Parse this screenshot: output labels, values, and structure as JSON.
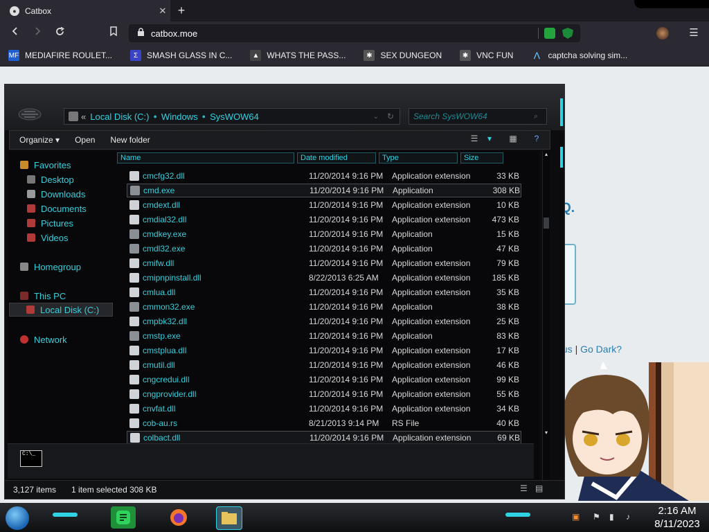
{
  "browser": {
    "tab_title": "Catbox",
    "tab_close": "✕",
    "new_tab": "+",
    "url": "catbox.moe",
    "bookmarks": [
      {
        "label": "MEDIAFIRE ROULET...",
        "icon": "mediafire-icon",
        "color": "#1f5fd1"
      },
      {
        "label": "SMASH GLASS IN C...",
        "icon": "smash-icon",
        "color": "#3b44c9"
      },
      {
        "label": "WHATS THE PASS...",
        "icon": "anon-icon",
        "color": "#444444"
      },
      {
        "label": "SEX DUNGEON",
        "icon": "spider-icon",
        "color": "#555555"
      },
      {
        "label": "VNC FUN",
        "icon": "spider-icon",
        "color": "#555555"
      },
      {
        "label": "captcha solving sim...",
        "icon": "a-logo-icon",
        "color": "#2b2a33"
      }
    ]
  },
  "webpage": {
    "fragment": "Q.",
    "link1": "tus",
    "separator": "|",
    "link2": "Go Dark?"
  },
  "explorer": {
    "address": [
      "Local Disk (C:)",
      "Windows",
      "SysWOW64"
    ],
    "address_prefix": "«",
    "search_placeholder": "Search SysWOW64",
    "commands": {
      "organize": "Organize ▾",
      "open": "Open",
      "new_folder": "New folder"
    },
    "nav": {
      "favorites": "Favorites",
      "desktop": "Desktop",
      "downloads": "Downloads",
      "documents": "Documents",
      "pictures": "Pictures",
      "videos": "Videos",
      "homegroup": "Homegroup",
      "this_pc": "This PC",
      "local_disk": "Local Disk (C:)",
      "network": "Network"
    },
    "columns": {
      "name": "Name",
      "date": "Date modified",
      "type": "Type",
      "size": "Size"
    },
    "files": [
      {
        "name": "cmcfg32.dll",
        "date": "11/20/2014 9:16 PM",
        "type": "Application extension",
        "size": "33 KB"
      },
      {
        "name": "cmd.exe",
        "date": "11/20/2014 9:16 PM",
        "type": "Application",
        "size": "308 KB"
      },
      {
        "name": "cmdext.dll",
        "date": "11/20/2014 9:16 PM",
        "type": "Application extension",
        "size": "10 KB"
      },
      {
        "name": "cmdial32.dll",
        "date": "11/20/2014 9:16 PM",
        "type": "Application extension",
        "size": "473 KB"
      },
      {
        "name": "cmdkey.exe",
        "date": "11/20/2014 9:16 PM",
        "type": "Application",
        "size": "15 KB"
      },
      {
        "name": "cmdl32.exe",
        "date": "11/20/2014 9:16 PM",
        "type": "Application",
        "size": "47 KB"
      },
      {
        "name": "cmifw.dll",
        "date": "11/20/2014 9:16 PM",
        "type": "Application extension",
        "size": "79 KB"
      },
      {
        "name": "cmipnpinstall.dll",
        "date": "8/22/2013 6:25 AM",
        "type": "Application extension",
        "size": "185 KB"
      },
      {
        "name": "cmlua.dll",
        "date": "11/20/2014 9:16 PM",
        "type": "Application extension",
        "size": "35 KB"
      },
      {
        "name": "cmmon32.exe",
        "date": "11/20/2014 9:16 PM",
        "type": "Application",
        "size": "38 KB"
      },
      {
        "name": "cmpbk32.dll",
        "date": "11/20/2014 9:16 PM",
        "type": "Application extension",
        "size": "25 KB"
      },
      {
        "name": "cmstp.exe",
        "date": "11/20/2014 9:16 PM",
        "type": "Application",
        "size": "83 KB"
      },
      {
        "name": "cmstplua.dll",
        "date": "11/20/2014 9:16 PM",
        "type": "Application extension",
        "size": "17 KB"
      },
      {
        "name": "cmutil.dll",
        "date": "11/20/2014 9:16 PM",
        "type": "Application extension",
        "size": "46 KB"
      },
      {
        "name": "cngcredui.dll",
        "date": "11/20/2014 9:16 PM",
        "type": "Application extension",
        "size": "99 KB"
      },
      {
        "name": "cngprovider.dll",
        "date": "11/20/2014 9:16 PM",
        "type": "Application extension",
        "size": "55 KB"
      },
      {
        "name": "cnvfat.dll",
        "date": "11/20/2014 9:16 PM",
        "type": "Application extension",
        "size": "34 KB"
      },
      {
        "name": "cob-au.rs",
        "date": "8/21/2013 9:14 PM",
        "type": "RS File",
        "size": "40 KB"
      },
      {
        "name": "colbact.dll",
        "date": "11/20/2014 9:16 PM",
        "type": "Application extension",
        "size": "69 KB"
      }
    ],
    "status": {
      "items": "3,127 items",
      "selected": "1 item selected  308 KB"
    }
  },
  "taskbar": {
    "time": "2:16 AM",
    "date": "8/11/2023"
  },
  "colors": {
    "accent": "#2fd3e3",
    "window_bg": "#0c0c0e"
  }
}
